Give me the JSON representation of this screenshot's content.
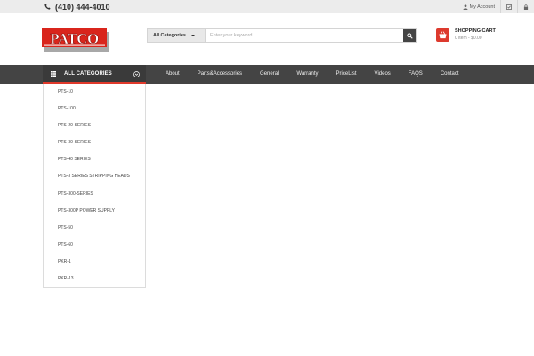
{
  "topbar": {
    "phone": "(410) 444-4010",
    "my_account": "My Account",
    "icons": [
      "user-icon",
      "checkbox-icon",
      "lock-icon"
    ]
  },
  "logo": {
    "text": "PATCO"
  },
  "search": {
    "category_label": "All Categories",
    "placeholder": "Enter your keyword..."
  },
  "cart": {
    "title": "SHOPPING CART",
    "summary": "0 item - $0.00"
  },
  "nav": {
    "all_categories": "ALL CATEGORIES",
    "links": [
      {
        "label": "About"
      },
      {
        "label": "Parts&Accessories"
      },
      {
        "label": "General"
      },
      {
        "label": "Warranty"
      },
      {
        "label": "PriceList"
      },
      {
        "label": "Videos"
      },
      {
        "label": "FAQS"
      },
      {
        "label": "Contact"
      }
    ]
  },
  "categories": [
    {
      "label": "PTS-10"
    },
    {
      "label": "PTS-100"
    },
    {
      "label": "PTS-20-SERIES"
    },
    {
      "label": "PTS-30-SERIES"
    },
    {
      "label": "PTS-40 SERIES"
    },
    {
      "label": "PTS-3 SERIES STRIPPING HEADS"
    },
    {
      "label": "PTS-300-SERIES"
    },
    {
      "label": "PTS-300P POWER SUPPLY"
    },
    {
      "label": "PTS-50"
    },
    {
      "label": "PTS-60"
    },
    {
      "label": "PKR-1"
    },
    {
      "label": "PKR-13"
    }
  ],
  "colors": {
    "accent": "#e0392b",
    "navbar": "#444444",
    "topbar": "#ececec"
  }
}
